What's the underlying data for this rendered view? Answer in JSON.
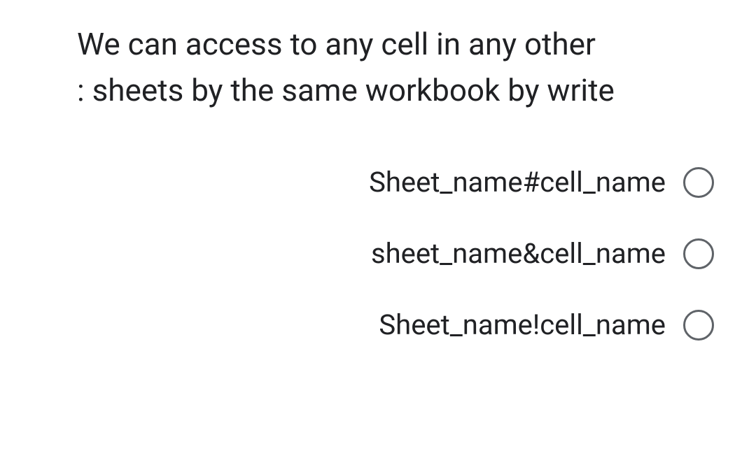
{
  "question": {
    "line1": "We can access to any cell in any other",
    "line2": ": sheets by the same workbook by write"
  },
  "options": [
    {
      "label": "Sheet_name#cell_name"
    },
    {
      "label": "sheet_name&cell_name"
    },
    {
      "label": "Sheet_name!cell_name"
    }
  ]
}
